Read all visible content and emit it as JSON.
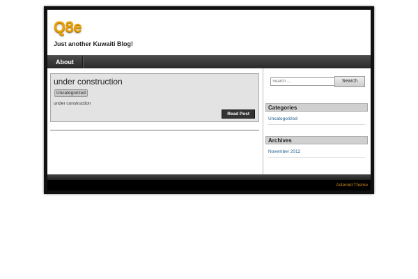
{
  "header": {
    "site_title": "Q8e",
    "tagline": "Just another Kuwaiti Blog!"
  },
  "nav": {
    "items": [
      {
        "label": "About"
      }
    ]
  },
  "post": {
    "title": "under construction",
    "category": "Uncategorized",
    "excerpt": "under construction",
    "read_more": "Read Post"
  },
  "sidebar": {
    "search": {
      "placeholder": "Search ...",
      "button": "Search"
    },
    "categories": {
      "title": "Categories",
      "items": [
        "Uncategorized"
      ]
    },
    "archives": {
      "title": "Archives",
      "items": [
        "November 2012"
      ]
    }
  },
  "footer": {
    "theme_credit": "Asteroid Theme"
  },
  "colors": {
    "logo": "#e9a100",
    "link": "#1d5a8a",
    "footer_link": "#d58a1a"
  }
}
